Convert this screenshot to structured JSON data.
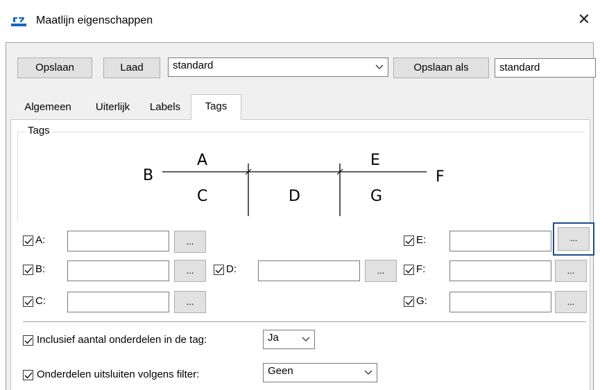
{
  "window": {
    "title": "Maatlijn eigenschappen",
    "close_label": "✕"
  },
  "toolbar": {
    "save_label": "Opslaan",
    "load_label": "Laad",
    "preset_value": "standard",
    "save_as_label": "Opslaan als",
    "save_as_value": "standard"
  },
  "tabs": [
    {
      "label": "Algemeen"
    },
    {
      "label": "Uiterlijk"
    },
    {
      "label": "Labels"
    },
    {
      "label": "Tags",
      "active": true
    }
  ],
  "tags_group": {
    "title": "Tags"
  },
  "diagram": {
    "labels": {
      "A": "A",
      "B": "B",
      "C": "C",
      "D": "D",
      "E": "E",
      "F": "F",
      "G": "G"
    }
  },
  "tag_fields": [
    {
      "label": "A:",
      "checked": true,
      "value": ""
    },
    {
      "label": "B:",
      "checked": true,
      "value": ""
    },
    {
      "label": "C:",
      "checked": true,
      "value": ""
    },
    {
      "label": "D:",
      "checked": true,
      "value": ""
    },
    {
      "label": "E:",
      "checked": true,
      "value": ""
    },
    {
      "label": "F:",
      "checked": true,
      "value": ""
    },
    {
      "label": "G:",
      "checked": true,
      "value": ""
    }
  ],
  "browse_label": "...",
  "options": {
    "include_count": {
      "label": "Inclusief aantal onderdelen in de tag:",
      "checked": true,
      "value": "Ja"
    },
    "exclude_filter": {
      "label": "Onderdelen uitsluiten volgens filter:",
      "checked": true,
      "value": "Geen"
    }
  },
  "colors": {
    "accent": "#1a4f86",
    "button_bg": "#e1e1e1",
    "frame_bg": "#f0f0f0"
  }
}
